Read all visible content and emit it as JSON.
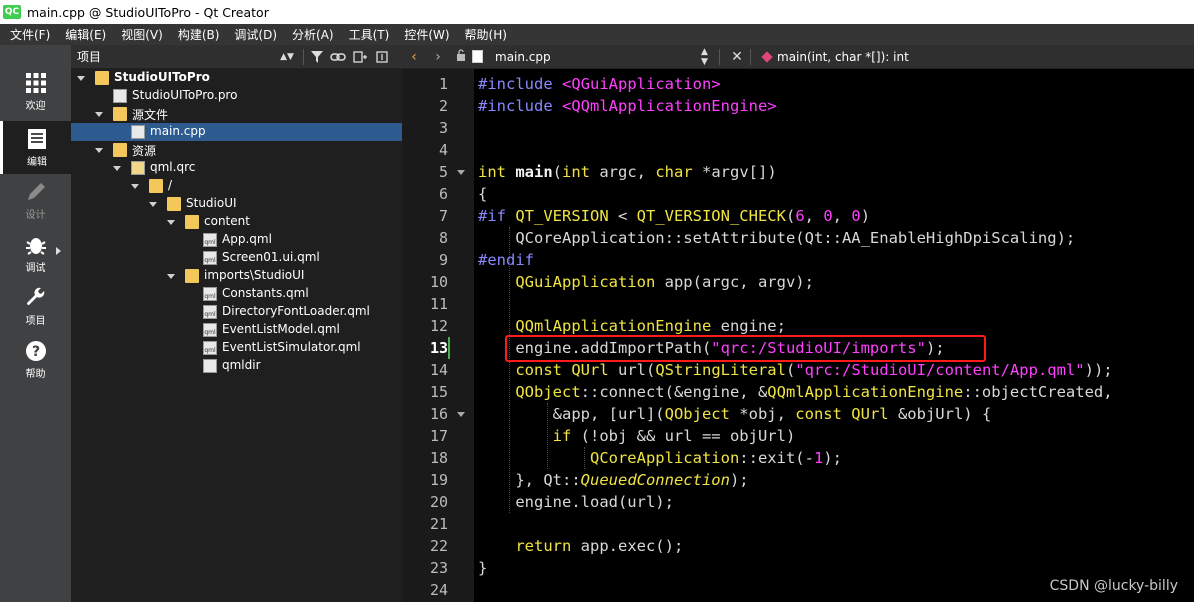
{
  "window": {
    "title": "main.cpp @ StudioUIToPro - Qt Creator",
    "logo_text": "QC"
  },
  "menubar": [
    "文件(F)",
    "编辑(E)",
    "视图(V)",
    "构建(B)",
    "调试(D)",
    "分析(A)",
    "工具(T)",
    "控件(W)",
    "帮助(H)"
  ],
  "modes": [
    {
      "label": "欢迎",
      "icon": "grid-icon",
      "active": false
    },
    {
      "label": "编辑",
      "icon": "edit-doc-icon",
      "active": true
    },
    {
      "label": "设计",
      "icon": "pen-icon",
      "active": false
    },
    {
      "label": "调试",
      "icon": "bug-icon",
      "active": false
    },
    {
      "label": "项目",
      "icon": "wrench-icon",
      "active": false
    },
    {
      "label": "帮助",
      "icon": "help-icon",
      "active": false
    }
  ],
  "project_panel": {
    "header_label": "项目",
    "tree": [
      {
        "name": "StudioUIToPro",
        "level": 0,
        "kind": "project",
        "expanded": true
      },
      {
        "name": "StudioUIToPro.pro",
        "level": 1,
        "kind": "file"
      },
      {
        "name": "源文件",
        "level": 1,
        "kind": "folder-src",
        "expanded": true
      },
      {
        "name": "main.cpp",
        "level": 2,
        "kind": "file",
        "selected": true
      },
      {
        "name": "资源",
        "level": 1,
        "kind": "folder-res",
        "expanded": true
      },
      {
        "name": "qml.qrc",
        "level": 2,
        "kind": "qrc",
        "expanded": true
      },
      {
        "name": "/",
        "level": 3,
        "kind": "folder",
        "expanded": true
      },
      {
        "name": "StudioUI",
        "level": 4,
        "kind": "folder",
        "expanded": true
      },
      {
        "name": "content",
        "level": 5,
        "kind": "folder",
        "expanded": true
      },
      {
        "name": "App.qml",
        "level": 6,
        "kind": "qml"
      },
      {
        "name": "Screen01.ui.qml",
        "level": 6,
        "kind": "qml"
      },
      {
        "name": "imports\\StudioUI",
        "level": 5,
        "kind": "folder",
        "expanded": true
      },
      {
        "name": "Constants.qml",
        "level": 6,
        "kind": "qml"
      },
      {
        "name": "DirectoryFontLoader.qml",
        "level": 6,
        "kind": "qml"
      },
      {
        "name": "EventListModel.qml",
        "level": 6,
        "kind": "qml"
      },
      {
        "name": "EventListSimulator.qml",
        "level": 6,
        "kind": "qml"
      },
      {
        "name": "qmldir",
        "level": 6,
        "kind": "file"
      }
    ]
  },
  "editor": {
    "file_name": "main.cpp",
    "symbol": "main(int, char *[]): int",
    "current_line": 13,
    "line_numbers": [
      "1",
      "2",
      "3",
      "4",
      "5",
      "6",
      "7",
      "8",
      "9",
      "10",
      "11",
      "12",
      "13",
      "14",
      "15",
      "16",
      "17",
      "18",
      "19",
      "20",
      "21",
      "22",
      "23",
      "24"
    ],
    "lines": [
      [
        [
          "pp",
          "#include "
        ],
        [
          "inc",
          "<QGuiApplication>"
        ]
      ],
      [
        [
          "pp",
          "#include "
        ],
        [
          "inc",
          "<QQmlApplicationEngine>"
        ]
      ],
      [],
      [],
      [
        [
          "kw",
          "int "
        ],
        [
          "fn",
          "main"
        ],
        [
          "plain",
          "("
        ],
        [
          "kw",
          "int "
        ],
        [
          "plain",
          "argc, "
        ],
        [
          "kw",
          "char "
        ],
        [
          "plain",
          "*argv[])"
        ]
      ],
      [
        [
          "plain",
          "{"
        ]
      ],
      [
        [
          "pp",
          "#if "
        ],
        [
          "cls",
          "QT_VERSION "
        ],
        [
          "plain",
          "< "
        ],
        [
          "cls",
          "QT_VERSION_CHECK"
        ],
        [
          "plain",
          "("
        ],
        [
          "num",
          "6"
        ],
        [
          "plain",
          ", "
        ],
        [
          "num",
          "0"
        ],
        [
          "plain",
          ", "
        ],
        [
          "num",
          "0"
        ],
        [
          "plain",
          ")"
        ]
      ],
      [
        [
          "plain",
          "    QCoreApplication::setAttribute(Qt::AA_EnableHighDpiScaling);"
        ]
      ],
      [
        [
          "pp",
          "#endif"
        ]
      ],
      [
        [
          "plain",
          "    "
        ],
        [
          "cls",
          "QGuiApplication "
        ],
        [
          "plain",
          "app(argc, argv);"
        ]
      ],
      [],
      [
        [
          "plain",
          "    "
        ],
        [
          "cls",
          "QQmlApplicationEngine "
        ],
        [
          "plain",
          "engine;"
        ]
      ],
      [
        [
          "plain",
          "    engine.addImportPath("
        ],
        [
          "str",
          "\"qrc:/StudioUI/imports\""
        ],
        [
          "plain",
          ");"
        ]
      ],
      [
        [
          "plain",
          "    "
        ],
        [
          "kw",
          "const "
        ],
        [
          "cls",
          "QUrl "
        ],
        [
          "plain",
          "url("
        ],
        [
          "cls",
          "QStringLiteral"
        ],
        [
          "plain",
          "("
        ],
        [
          "str",
          "\"qrc:/StudioUI/content/App.qml\""
        ],
        [
          "plain",
          "));"
        ]
      ],
      [
        [
          "plain",
          "    "
        ],
        [
          "cls",
          "QObject"
        ],
        [
          "plain",
          "::connect(&engine, &"
        ],
        [
          "cls",
          "QQmlApplicationEngine"
        ],
        [
          "plain",
          "::objectCreated,"
        ]
      ],
      [
        [
          "plain",
          "        &app, [url]("
        ],
        [
          "cls",
          "QObject "
        ],
        [
          "plain",
          "*obj, "
        ],
        [
          "kw",
          "const "
        ],
        [
          "cls",
          "QUrl "
        ],
        [
          "plain",
          "&objUrl) {"
        ]
      ],
      [
        [
          "plain",
          "        "
        ],
        [
          "kw",
          "if "
        ],
        [
          "plain",
          "(!obj && url == objUrl)"
        ]
      ],
      [
        [
          "plain",
          "            "
        ],
        [
          "cls",
          "QCoreApplication"
        ],
        [
          "plain",
          "::exit(-"
        ],
        [
          "num",
          "1"
        ],
        [
          "plain",
          ");"
        ]
      ],
      [
        [
          "plain",
          "    }, Qt::"
        ],
        [
          "it",
          "QueuedConnection"
        ],
        [
          "plain",
          ");"
        ]
      ],
      [
        [
          "plain",
          "    engine.load(url);"
        ]
      ],
      [],
      [
        [
          "plain",
          "    "
        ],
        [
          "kw",
          "return "
        ],
        [
          "plain",
          "app.exec();"
        ]
      ],
      [
        [
          "plain",
          "}"
        ]
      ],
      []
    ]
  },
  "watermark": "CSDN @lucky-billy"
}
